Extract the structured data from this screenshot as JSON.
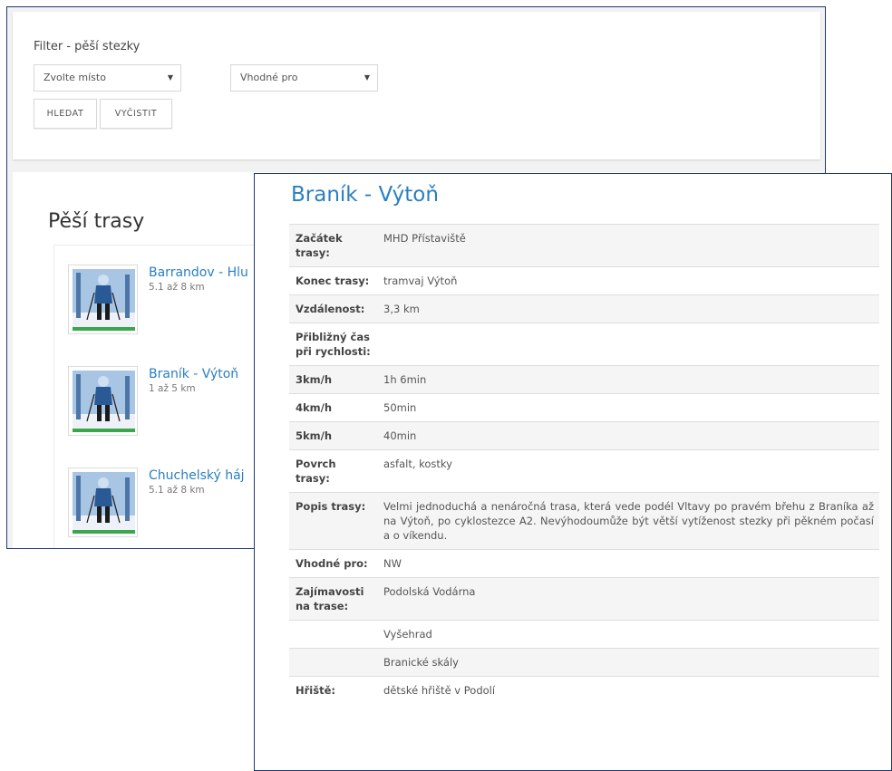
{
  "filter": {
    "title": "Filter - pěší stezky",
    "place_select": "Zvolte místo",
    "suitable_select": "Vhodné pro",
    "search_button": "HLEDAT",
    "clear_button": "VYČISTIT"
  },
  "trails": {
    "heading": "Pěší trasy",
    "items": [
      {
        "name": "Barrandov - Hlu",
        "distance": "5.1 až 8 km"
      },
      {
        "name": "Braník - Výtoň",
        "distance": "1 až 5 km"
      },
      {
        "name": "Chuchelský háj",
        "distance": "5.1 až 8 km"
      }
    ]
  },
  "detail": {
    "title": "Braník - Výtoň",
    "rows": [
      {
        "label": "Začátek trasy:",
        "value": "MHD Přístaviště"
      },
      {
        "label": "Konec trasy:",
        "value": "tramvaj Výtoň"
      },
      {
        "label": "Vzdálenost:",
        "value": "3,3 km"
      },
      {
        "label": "Přibližný čas při rychlosti:",
        "value": ""
      },
      {
        "label": "3km/h",
        "value": "1h 6min"
      },
      {
        "label": "4km/h",
        "value": "50min"
      },
      {
        "label": "5km/h",
        "value": "40min"
      },
      {
        "label": "Povrch trasy:",
        "value": "asfalt, kostky"
      },
      {
        "label": "Popis trasy:",
        "value": "Velmi jednoduchá a nenáročná trasa, která vede podél Vltavy po pravém břehu z Braníka až na Výtoň, po cyklostezce A2. Nevýhodoumůže být větší vytíženost stezky při pěkném počasí a o víkendu."
      },
      {
        "label": "Vhodné pro:",
        "value": "NW"
      },
      {
        "label": "Zajímavosti na trase:",
        "value": "Podolská Vodárna"
      },
      {
        "label": "",
        "value": "Vyšehrad"
      },
      {
        "label": "",
        "value": "Branické skály"
      },
      {
        "label": "Hřiště:",
        "value": "dětské hřiště v Podolí"
      }
    ]
  },
  "colors": {
    "accent": "#2a7fc1",
    "window_border": "#1f3a6e"
  }
}
